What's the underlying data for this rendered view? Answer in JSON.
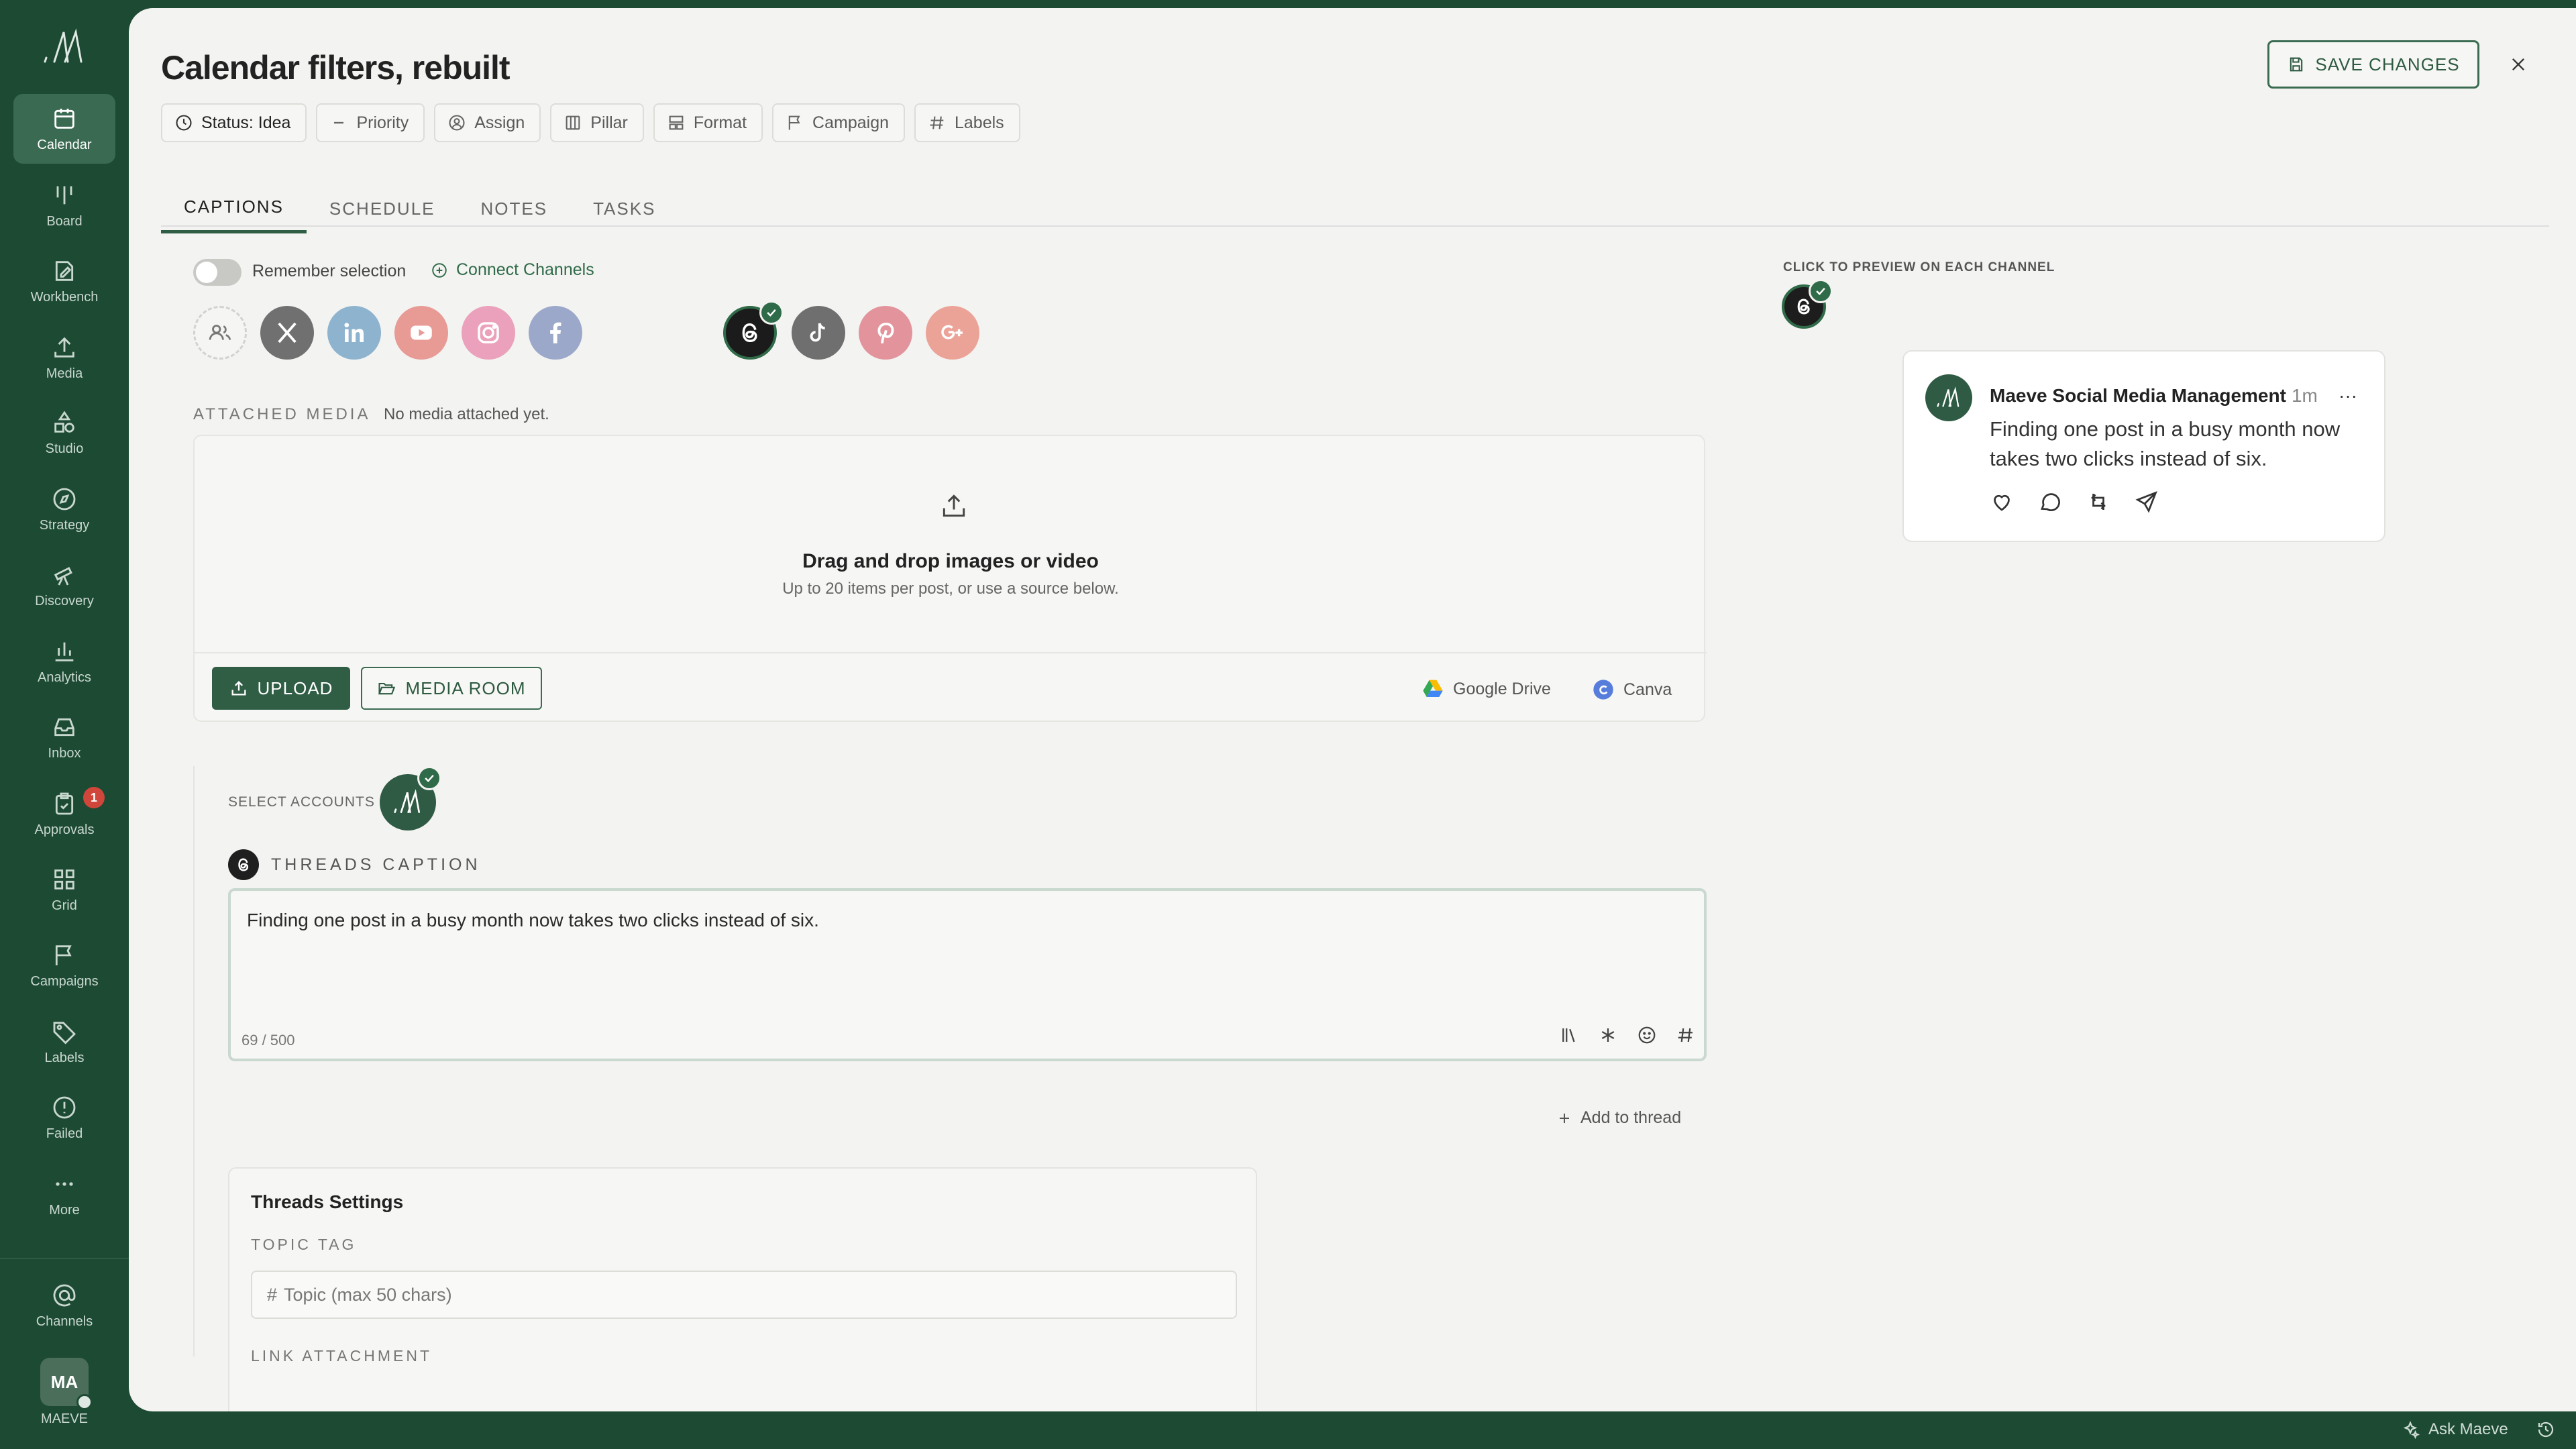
{
  "sidebar": {
    "items": [
      {
        "label": "Calendar",
        "icon": "calendar-icon",
        "active": true
      },
      {
        "label": "Board",
        "icon": "board-icon"
      },
      {
        "label": "Workbench",
        "icon": "workbench-icon"
      },
      {
        "label": "Media",
        "icon": "upload-icon"
      },
      {
        "label": "Studio",
        "icon": "shapes-icon"
      },
      {
        "label": "Strategy",
        "icon": "compass-icon"
      },
      {
        "label": "Discovery",
        "icon": "telescope-icon"
      },
      {
        "label": "Analytics",
        "icon": "bar-chart-icon"
      },
      {
        "label": "Inbox",
        "icon": "inbox-icon"
      },
      {
        "label": "Approvals",
        "icon": "clipboard-check-icon",
        "badge": "1"
      },
      {
        "label": "Grid",
        "icon": "grid-icon"
      },
      {
        "label": "Campaigns",
        "icon": "flag-icon"
      },
      {
        "label": "Labels",
        "icon": "tag-icon"
      },
      {
        "label": "Failed",
        "icon": "alert-circle-icon"
      },
      {
        "label": "More",
        "icon": "more-icon"
      }
    ],
    "channels_label": "Channels",
    "user_initials": "MA",
    "user_label": "MAEVE"
  },
  "header": {
    "title": "Calendar filters, rebuilt",
    "save_label": "SAVE CHANGES"
  },
  "chips": [
    {
      "label": "Status: Idea",
      "icon": "status-circle-icon"
    },
    {
      "label": "Priority",
      "icon": "minus-icon"
    },
    {
      "label": "Assign",
      "icon": "user-circle-icon"
    },
    {
      "label": "Pillar",
      "icon": "columns-icon"
    },
    {
      "label": "Format",
      "icon": "layout-icon"
    },
    {
      "label": "Campaign",
      "icon": "flag-icon"
    },
    {
      "label": "Labels",
      "icon": "hash-icon"
    }
  ],
  "tabs": [
    "CAPTIONS",
    "SCHEDULE",
    "NOTES",
    "TASKS"
  ],
  "active_tab": "CAPTIONS",
  "compose": {
    "remember_label": "Remember selection",
    "connect_label": "Connect Channels",
    "channels": [
      "group",
      "x",
      "linkedin",
      "youtube",
      "instagram",
      "facebook",
      "threads",
      "tiktok",
      "pinterest",
      "google-plus"
    ],
    "selected_channel": "threads",
    "attached_label": "ATTACHED MEDIA",
    "attached_empty": "No media attached yet.",
    "drop_title": "Drag and drop images or video",
    "drop_sub": "Up to 20 items per post, or use a source below.",
    "upload_label": "UPLOAD",
    "media_room_label": "MEDIA ROOM",
    "gdrive_label": "Google Drive",
    "canva_label": "Canva",
    "select_accounts_label": "SELECT ACCOUNTS",
    "caption_label": "THREADS CAPTION",
    "caption_text": "Finding one post in a busy month now takes two clicks instead of six.",
    "caption_count": "69 / 500",
    "add_thread_label": "Add to thread",
    "settings_title": "Threads Settings",
    "topic_tag_label": "TOPIC TAG",
    "topic_placeholder": "Topic (max 50 chars)",
    "link_attachment_label": "LINK ATTACHMENT"
  },
  "preview": {
    "label": "CLICK TO PREVIEW ON EACH CHANNEL",
    "name": "Maeve Social Media Management",
    "time": "1m",
    "menu": "···",
    "text": "Finding one post in a busy month now takes two clicks instead of six."
  },
  "footer": {
    "ask_label": "Ask Maeve"
  },
  "colors": {
    "brand_dark": "#1d4a33",
    "accent": "#2f5e45",
    "panel_bg": "#f3f3f1"
  }
}
